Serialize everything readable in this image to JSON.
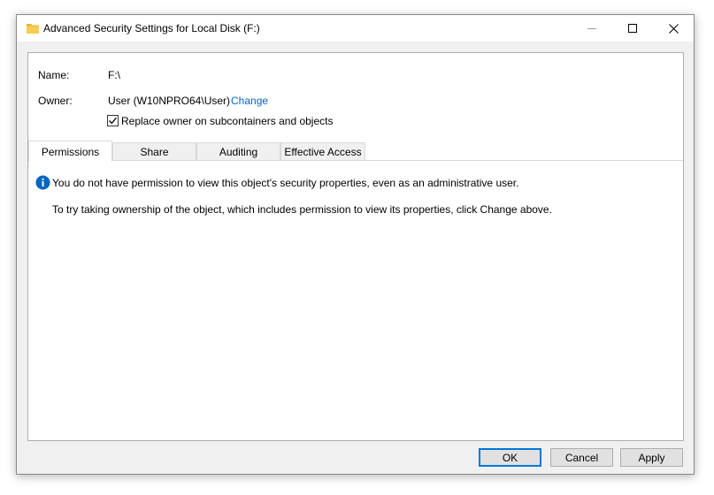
{
  "window": {
    "title": "Advanced Security Settings for Local Disk (F:)",
    "icons": {
      "title": "folder-icon",
      "minimize": "minimize-icon",
      "maximize": "maximize-icon",
      "close": "close-icon"
    }
  },
  "details": {
    "name_label": "Name:",
    "name_value": "F:\\",
    "owner_label": "Owner:",
    "owner_value": "User (W10NPRO64\\User)",
    "change_link": "Change",
    "replace_owner_label": "Replace owner on subcontainers and objects",
    "replace_owner_checked": true
  },
  "tabs": [
    {
      "label": "Permissions",
      "active": true
    },
    {
      "label": "Share",
      "active": false
    },
    {
      "label": "Auditing",
      "active": false
    },
    {
      "label": "Effective Access",
      "active": false
    }
  ],
  "messages": {
    "info_icon": "info-icon",
    "no_permission": "You do not have permission to view this object's security properties, even as an administrative user.",
    "take_ownership": "To try taking ownership of the object, which includes permission to view its properties, click Change above."
  },
  "buttons": {
    "ok": "OK",
    "cancel": "Cancel",
    "apply": "Apply"
  },
  "colors": {
    "link": "#0066cc",
    "info": "#0067c0",
    "default_button_border": "#0078d7",
    "folder": "#e8b530"
  }
}
